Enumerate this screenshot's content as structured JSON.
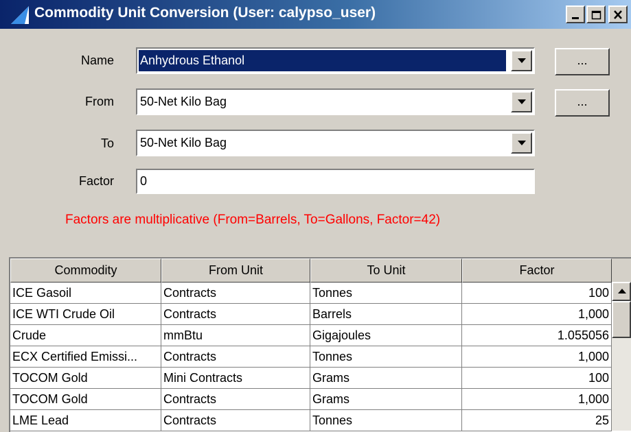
{
  "window": {
    "title": "Commodity Unit Conversion (User: calypso_user)",
    "accent": "#0a246a"
  },
  "form": {
    "name_label": "Name",
    "name_value": "Anhydrous Ethanol",
    "from_label": "From",
    "from_value": "50-Net Kilo Bag",
    "to_label": "To",
    "to_value": "50-Net Kilo Bag",
    "factor_label": "Factor",
    "factor_value": "0",
    "ellipsis_label": "...",
    "note": "Factors are multiplicative (From=Barrels, To=Gallons, Factor=42)",
    "note_color": "#ff0000"
  },
  "table": {
    "columns": [
      "Commodity",
      "From Unit",
      "To Unit",
      "Factor"
    ],
    "rows": [
      [
        "ICE Gasoil",
        "Contracts",
        "Tonnes",
        "100"
      ],
      [
        "ICE WTI Crude Oil",
        "Contracts",
        "Barrels",
        "1,000"
      ],
      [
        "Crude",
        "mmBtu",
        "Gigajoules",
        "1.055056"
      ],
      [
        "ECX Certified Emissi...",
        "Contracts",
        "Tonnes",
        "1,000"
      ],
      [
        "TOCOM Gold",
        "Mini Contracts",
        "Grams",
        "100"
      ],
      [
        "TOCOM Gold",
        "Contracts",
        "Grams",
        "1,000"
      ],
      [
        "LME Lead",
        "Contracts",
        "Tonnes",
        "25"
      ]
    ]
  }
}
